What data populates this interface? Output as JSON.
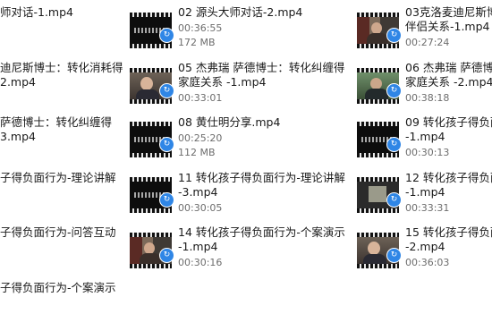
{
  "files": [
    {
      "line1": "师对话-1.mp4"
    },
    {
      "line1": "02 源头大师对话-2.mp4",
      "duration": "00:36:55",
      "size": "172 MB",
      "icon": "sync-icon"
    },
    {
      "line1": "03克洛麦迪尼斯博",
      "line2": "伴侣关系-1.mp4",
      "duration": "00:27:24",
      "icon": "sync-icon"
    },
    {
      "line1": "迪尼斯博士：转化消耗得",
      "line2": "2.mp4"
    },
    {
      "line1": "05 杰弗瑞 萨德博士：转化纠缠得",
      "line2": "家庭关系 -1.mp4",
      "duration": "00:33:01",
      "icon": "sync-icon"
    },
    {
      "line1": "06 杰弗瑞 萨德博",
      "line2": "家庭关系 -2.mp4",
      "duration": "00:38:18",
      "icon": "sync-icon"
    },
    {
      "line1": "萨德博士：转化纠缠得",
      "line2": "3.mp4"
    },
    {
      "line1": "08 黄仕明分享.mp4",
      "duration": "00:25:20",
      "size": "112 MB",
      "icon": "sync-icon"
    },
    {
      "line1": "09  转化孩子得负面",
      "line2": "-1.mp4",
      "duration": "00:30:13",
      "icon": "sync-icon"
    },
    {
      "line1": "子得负面行为-理论讲解"
    },
    {
      "line1": "11 转化孩子得负面行为-理论讲解",
      "line2": "-3.mp4",
      "duration": "00:30:05",
      "icon": "sync-icon"
    },
    {
      "line1": "12 转化孩子得负面",
      "line2": "-1.mp4",
      "duration": "00:33:31",
      "icon": "sync-icon"
    },
    {
      "line1": "子得负面行为-问答互动"
    },
    {
      "line1": "14 转化孩子得负面行为-个案演示",
      "line2": "-1.mp4",
      "duration": "00:30:16",
      "icon": "sync-icon"
    },
    {
      "line1": "15 转化孩子得负面",
      "line2": "-2.mp4",
      "duration": "00:36:03",
      "icon": "sync-icon"
    },
    {
      "line1": "子得负面行为-个案演示"
    }
  ]
}
